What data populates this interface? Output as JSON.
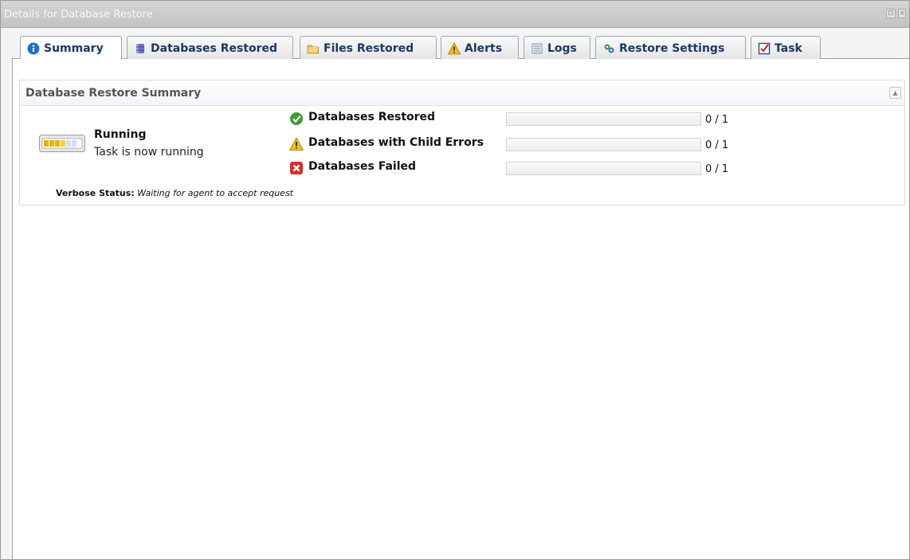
{
  "window": {
    "title": "Details for Database Restore",
    "restore_glyph": "⊡",
    "close_glyph": "×"
  },
  "tabs": [
    {
      "label": "Summary",
      "icon": "info-icon",
      "active": true
    },
    {
      "label": "Databases Restored",
      "icon": "database-icon",
      "active": false
    },
    {
      "label": "Files Restored",
      "icon": "folder-icon",
      "active": false
    },
    {
      "label": "Alerts",
      "icon": "warning-icon",
      "active": false
    },
    {
      "label": "Logs",
      "icon": "log-icon",
      "active": false
    },
    {
      "label": "Restore Settings",
      "icon": "settings-icon",
      "active": false
    },
    {
      "label": "Task",
      "icon": "task-icon",
      "active": false
    }
  ],
  "panel": {
    "title": "Database Restore Summary",
    "collapse_glyph": "▲"
  },
  "status": {
    "title": "Running",
    "subtitle": "Task is now running",
    "icon": "progress-running-icon"
  },
  "metrics": [
    {
      "label": "Databases Restored",
      "icon": "check-circle-icon",
      "count": "0 / 1",
      "progress": 0
    },
    {
      "label": "Databases with Child Errors",
      "icon": "warning-icon",
      "count": "0 / 1",
      "progress": 0
    },
    {
      "label": "Databases Failed",
      "icon": "error-x-icon",
      "count": "0 / 1",
      "progress": 0
    }
  ],
  "verbose": {
    "label": "Verbose Status:",
    "value": "Waiting for agent to accept request"
  },
  "colors": {
    "tab_text": "#1a3768",
    "success": "#3aa12d",
    "warning": "#f2c300",
    "error": "#d93025"
  }
}
